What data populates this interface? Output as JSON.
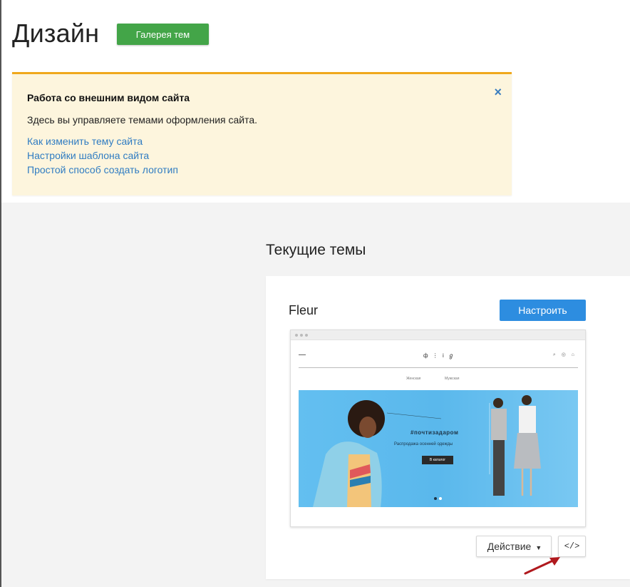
{
  "page": {
    "title": "Дизайн",
    "gallery_button": "Галерея тем"
  },
  "notice": {
    "title": "Работа со внешним видом сайта",
    "text": "Здесь вы управляете темами оформления сайта.",
    "links": [
      "Как изменить тему сайта",
      "Настройки шаблона сайта",
      "Простой способ создать логотип"
    ],
    "close_icon": "×",
    "accent_color": "#f0a81c"
  },
  "current_themes": {
    "heading": "Текущие темы",
    "theme": {
      "name": "Fleur",
      "configure_button": "Настроить",
      "action_button": "Действие",
      "code_button": "</>",
      "preview": {
        "logo": "ф ⋮ і ℊ",
        "icons": "⌕ ◎ ⌂",
        "nav": [
          "Женская",
          "Мужская"
        ],
        "hashtag": "#почтизадаром",
        "subtitle": "Распродажа осенней одежды",
        "cta": "В каталог"
      }
    }
  },
  "colors": {
    "gallery_button": "#43a548",
    "configure_button": "#2d8de0",
    "link": "#2f7cc2",
    "arrow": "#b0191e"
  }
}
